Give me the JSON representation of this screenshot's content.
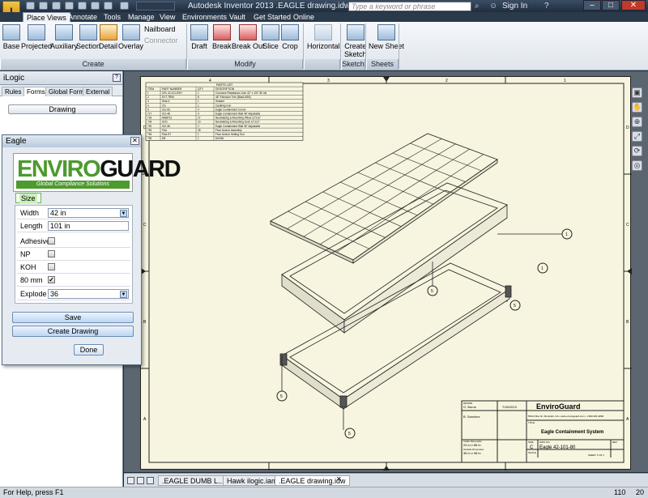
{
  "titlebar": {
    "title": "Autodesk Inventor 2013   .EAGLE drawing.idw",
    "app_letter": "I",
    "project": "",
    "search_placeholder": "Type a keyword or phrase",
    "sign_in": "Sign In",
    "minimize": "–",
    "maximize": "□",
    "close": "✕"
  },
  "tabs": [
    "Place Views",
    "Annotate",
    "Tools",
    "Manage",
    "View",
    "Environments",
    "Vault",
    "Get Started",
    "Online"
  ],
  "ribbon": {
    "create": {
      "buttons": [
        "Base",
        "Projected",
        "Auxiliary",
        "Section",
        "Detail",
        "Overlay"
      ],
      "nailboard": "Nailboard",
      "connector": "Connector",
      "label": "Create"
    },
    "modify": {
      "buttons": [
        "Draft",
        "Break",
        "Break Out",
        "Slice",
        "Crop"
      ],
      "horizontal": "Horizontal",
      "label": "Modify"
    },
    "sketch": {
      "button_line1": "Create",
      "button_line2": "Sketch",
      "label": "Sketch"
    },
    "sheets": {
      "button": "New Sheet",
      "label": "Sheets"
    }
  },
  "ilogic": {
    "title": "iLogic",
    "tabs": [
      "Rules",
      "Forms",
      "Global Forms",
      "External"
    ],
    "active_tab": "Forms",
    "drawing_button": "Drawing"
  },
  "dialog": {
    "title": "Eagle",
    "logo_green": "ENVIRO",
    "logo_dark": "GUARD",
    "tagline": "Global Compliance Solutions",
    "tab": "Size",
    "width_label": "Width",
    "width_value": "42 in",
    "length_label": "Length",
    "length_value": "101 in",
    "adhesive_label": "Adhesive",
    "adhesive_checked": false,
    "np_label": "NP",
    "np_checked": false,
    "koh_label": "KOH",
    "koh_checked": false,
    "mm80_label": "80 mm",
    "mm80_checked": true,
    "explode_label": "Explode",
    "explode_value": "36",
    "save": "Save",
    "create_drawing": "Create Drawing",
    "done": "Done"
  },
  "parts_list": {
    "title": "PARTS LIST",
    "headers": [
      "ITEM",
      "PART NUMBER",
      "QTY",
      "DESCRIPTION"
    ],
    "rows": [
      [
        "1",
        "CRL 42-101-ESH",
        "1",
        "Corrosive Resistance Liner 42\" x 101\" 80 mil"
      ],
      [
        "2",
        "EXT-TRIM",
        "8",
        "48\" Extrusion Trim (Black ABS)"
      ],
      [
        "3",
        "Seal-4",
        "1",
        "Sealant"
      ],
      [
        "4",
        "CG",
        "1",
        "Caulking Gun"
      ],
      [
        "5",
        "011-06",
        "4",
        "Eagle Containment Corner"
      ],
      [
        "717",
        "012-48",
        "4",
        "Eagle Containment Wall 48\" Adjustable"
      ],
      [
        "733",
        "NABP12",
        "27",
        "Neutralizing & Absorbing Pillow 12\"x12\""
      ],
      [
        "734",
        "SOC",
        "10",
        "Neutralizing & Absorbing Sock 12\"x12\""
      ],
      [
        "752",
        "012-36",
        "2",
        "Eagle Containment Wall 36\" Adjustable"
      ],
      [
        "753",
        "FAA",
        "28",
        "Floor Anchor Assembly"
      ],
      [
        "754",
        "FAA-ST",
        "1",
        "Floor Anchor Setting Tool"
      ],
      [
        "755",
        "DB",
        "1",
        "Drill Bit"
      ]
    ]
  },
  "titleblock": {
    "company": "EnviroGuard",
    "address": "5534 Olive St. Montclair, CA • www.enviroguard.com • 1.800.281.9884",
    "drawn_label": "DRAWN",
    "drawn_by": "G. Burns",
    "date": "7/16/2013",
    "checked_by": "B. Sanchez",
    "title_label": "TITLE",
    "title": "Eagle Containment System",
    "inside_dim_label": "Inside Dimension",
    "inside_dim": "24 in x 86 in",
    "outside_dim_label": "Outside Dimension",
    "outside_dim": "36 in x 98 in",
    "size_label": "SIZE",
    "size": "C",
    "dwg_label": "DWG NO",
    "dwg_no": "Eagle 42-101-80",
    "rev_label": "REV",
    "scale_label": "SCALE",
    "sheet": "SHEET 1  OF 1"
  },
  "zones": {
    "top": [
      "4",
      "3",
      "2",
      "1"
    ],
    "side": [
      "D",
      "C",
      "B",
      "A"
    ]
  },
  "balloons": [
    "1",
    "5",
    "1",
    "5",
    "5",
    "5"
  ],
  "nav_icons": [
    "view-cube-icon",
    "pan-icon",
    "zoom-icon",
    "zoom-all-icon",
    "orbit-icon",
    "look-at-icon"
  ],
  "doc_tabs": [
    ".EAGLE DUMB L...iam",
    "Hawk ilogic.iam",
    ".EAGLE drawing.idw"
  ],
  "status": {
    "help": "For Help, press F1",
    "n1": "110",
    "n2": "20"
  }
}
